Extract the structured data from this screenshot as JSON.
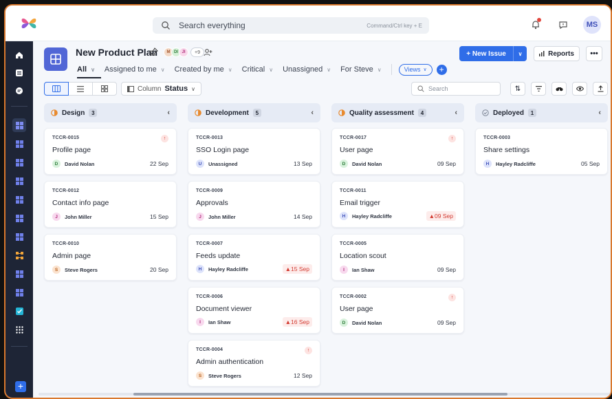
{
  "search": {
    "placeholder": "Search everything",
    "shortcut": "Command/Ctrl key + E"
  },
  "user": {
    "initials": "MS"
  },
  "project": {
    "title": "New Product Plan",
    "members": [
      {
        "initials": "M",
        "bg": "#f3d9c7",
        "fg": "#a4552b"
      },
      {
        "initials": "DI",
        "bg": "#d6f0d8",
        "fg": "#2e7d3a"
      },
      {
        "initials": "JI",
        "bg": "#f8d7ea",
        "fg": "#b02a7a"
      }
    ],
    "more_members": "+9"
  },
  "filters": [
    "All",
    "Assigned to me",
    "Created by me",
    "Critical",
    "Unassigned",
    "For Steve"
  ],
  "views_label": "Views",
  "actions": {
    "new_issue": "New Issue",
    "reports": "Reports"
  },
  "toolbar": {
    "column_label": "Column",
    "column_value": "Status",
    "search_placeholder": "Search"
  },
  "columns": [
    {
      "name": "Design",
      "count": "3",
      "status_color": "#e88a2e",
      "cards": [
        {
          "code": "TCCR-0015",
          "title": "Profile page",
          "assignee": "David Nolan",
          "initial": "D",
          "av_bg": "#d9f2dd",
          "av_fg": "#2e7d3a",
          "date": "22 Sep",
          "overdue": false,
          "priority": true
        },
        {
          "code": "TCCR-0012",
          "title": "Contact info page",
          "assignee": "John Miller",
          "initial": "J",
          "av_bg": "#f8d9ee",
          "av_fg": "#b02a7a",
          "date": "15 Sep",
          "overdue": false,
          "priority": false
        },
        {
          "code": "TCCR-0010",
          "title": "Admin page",
          "assignee": "Steve Rogers",
          "initial": "S",
          "av_bg": "#fbe3cf",
          "av_fg": "#b8611f",
          "date": "20 Sep",
          "overdue": false,
          "priority": false
        }
      ]
    },
    {
      "name": "Development",
      "count": "5",
      "status_color": "#e88a2e",
      "cards": [
        {
          "code": "TCCR-0013",
          "title": "SSO Login page",
          "assignee": "Unassigned",
          "initial": "U",
          "av_bg": "#dde3fb",
          "av_fg": "#3e4fb8",
          "date": "13 Sep",
          "overdue": false,
          "priority": false
        },
        {
          "code": "TCCR-0009",
          "title": "Approvals",
          "assignee": "John Miller",
          "initial": "J",
          "av_bg": "#f8d9ee",
          "av_fg": "#b02a7a",
          "date": "14 Sep",
          "overdue": false,
          "priority": false
        },
        {
          "code": "TCCR-0007",
          "title": "Feeds update",
          "assignee": "Hayley Radcliffe",
          "initial": "H",
          "av_bg": "#dde3fb",
          "av_fg": "#3e4fb8",
          "date": "15 Sep",
          "overdue": true,
          "priority": false
        },
        {
          "code": "TCCR-0006",
          "title": "Document viewer",
          "assignee": "Ian Shaw",
          "initial": "I",
          "av_bg": "#f8d9ee",
          "av_fg": "#b02a7a",
          "date": "16 Sep",
          "overdue": true,
          "priority": false
        },
        {
          "code": "TCCR-0004",
          "title": "Admin authentication",
          "assignee": "Steve Rogers",
          "initial": "S",
          "av_bg": "#fbe3cf",
          "av_fg": "#b8611f",
          "date": "12 Sep",
          "overdue": false,
          "priority": true
        }
      ]
    },
    {
      "name": "Quality assessment",
      "count": "4",
      "status_color": "#e88a2e",
      "cards": [
        {
          "code": "TCCR-0017",
          "title": "User page",
          "assignee": "David Nolan",
          "initial": "D",
          "av_bg": "#d9f2dd",
          "av_fg": "#2e7d3a",
          "date": "09 Sep",
          "overdue": false,
          "priority": true
        },
        {
          "code": "TCCR-0011",
          "title": "Email trigger",
          "assignee": "Hayley Radcliffe",
          "initial": "H",
          "av_bg": "#dde3fb",
          "av_fg": "#3e4fb8",
          "date": "09 Sep",
          "overdue": true,
          "priority": false
        },
        {
          "code": "TCCR-0005",
          "title": "Location scout",
          "assignee": "Ian Shaw",
          "initial": "I",
          "av_bg": "#f8d9ee",
          "av_fg": "#b02a7a",
          "date": "09 Sep",
          "overdue": false,
          "priority": false
        },
        {
          "code": "TCCR-0002",
          "title": "User page",
          "assignee": "David Nolan",
          "initial": "D",
          "av_bg": "#d9f2dd",
          "av_fg": "#2e7d3a",
          "date": "09 Sep",
          "overdue": false,
          "priority": true
        }
      ]
    },
    {
      "name": "Deployed",
      "count": "1",
      "status_color": "#7b8494",
      "cards": [
        {
          "code": "TCCR-0003",
          "title": "Share settings",
          "assignee": "Hayley Radcliffe",
          "initial": "H",
          "av_bg": "#dde3fb",
          "av_fg": "#3e4fb8",
          "date": "05 Sep",
          "overdue": false,
          "priority": false
        }
      ]
    }
  ]
}
